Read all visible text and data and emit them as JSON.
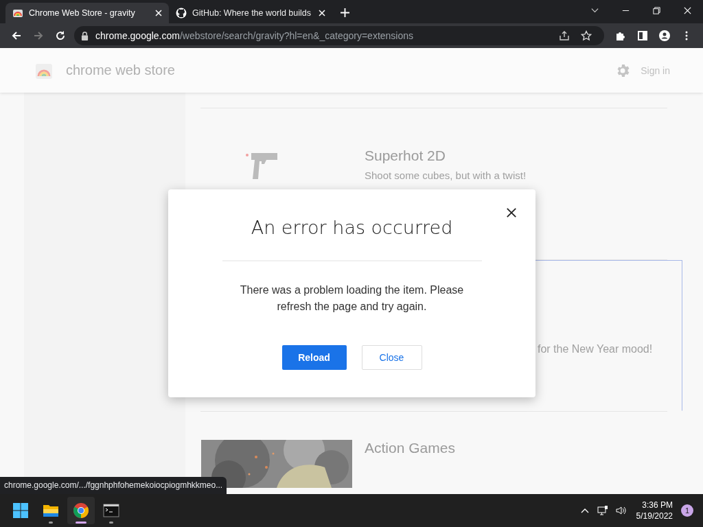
{
  "tabs": [
    {
      "title": "Chrome Web Store - gravity",
      "selected": true
    },
    {
      "title": "GitHub: Where the world builds",
      "selected": false
    }
  ],
  "address": {
    "host": "chrome.google.com",
    "path": "/webstore/search/gravity?hl=en&_category=extensions"
  },
  "store_header": {
    "title": "chrome web store",
    "sign_in": "Sign in"
  },
  "results": [
    {
      "title": "Superhot 2D",
      "description": "Shoot some cubes, but with a twist!",
      "highlighted": false,
      "kind": "gun"
    },
    {
      "description": "for the New Year mood!",
      "highlighted": true,
      "kind": "hidden"
    },
    {
      "title": "Action Games",
      "highlighted": false,
      "kind": "picture"
    }
  ],
  "dialog": {
    "title": "An error has occurred",
    "message": "There was a problem loading the item. Please refresh the page and try again.",
    "buttons": [
      {
        "label": "Reload",
        "kind": "primary"
      },
      {
        "label": "Close",
        "kind": "secondary"
      }
    ]
  },
  "status_url": "chrome.google.com/.../fggnhphfohemekoiocpiogmhkkmeo...",
  "taskbar": {
    "apps": [
      {
        "kind": "start",
        "running": false,
        "selected": false
      },
      {
        "kind": "explorer",
        "running": true,
        "selected": false
      },
      {
        "kind": "chrome",
        "running": true,
        "selected": true
      },
      {
        "kind": "terminal",
        "running": true,
        "selected": false
      }
    ],
    "time": "3:36 PM",
    "date": "5/19/2022",
    "notifications": "1"
  }
}
